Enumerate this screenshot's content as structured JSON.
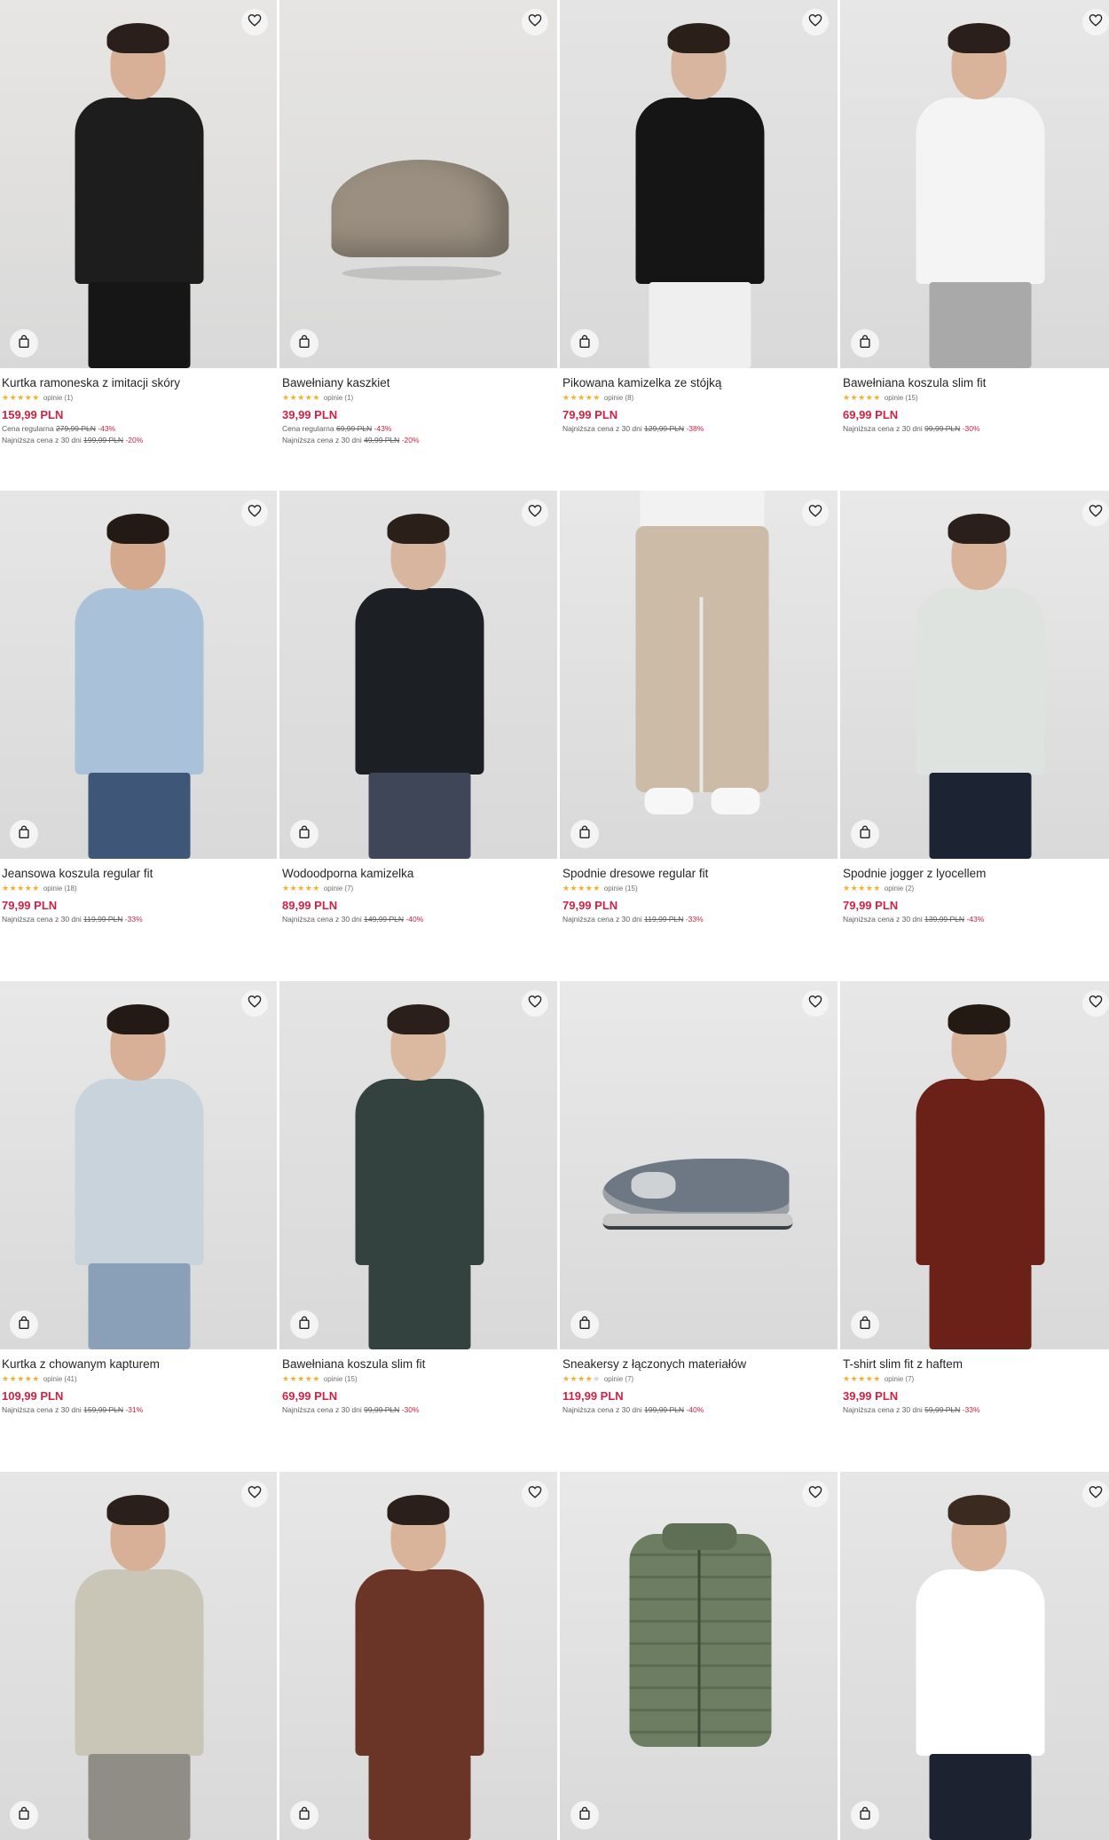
{
  "products": [
    {
      "name": "Kurtka ramoneska z imitacji skóry",
      "stars": 5,
      "reviews": "opinie (1)",
      "price": "159,99 PLN",
      "regular_label": "Cena regularna",
      "regular_old": "279,99 PLN",
      "regular_disc": "-43%",
      "lowest_label": "Najniższa cena z 30 dni",
      "lowest_old": "199,99 PLN",
      "lowest_disc": "-20%",
      "image": "model-black-leather-jacket",
      "bg": "#e8e6e4",
      "skin": "#d7b097",
      "top": "#1d1d1d",
      "bottom": "#161616",
      "hair": "#2a1f1a"
    },
    {
      "name": "Bawełniany kaszkiet",
      "stars": 5,
      "reviews": "opinie (1)",
      "price": "39,99 PLN",
      "regular_label": "Cena regularna",
      "regular_old": "69,99 PLN",
      "regular_disc": "-43%",
      "lowest_label": "Najniższa cena z 30 dni",
      "lowest_old": "49,99 PLN",
      "lowest_disc": "-20%",
      "image": "flat-cap",
      "bg": "#e6e5e3",
      "top": "#9a8f80"
    },
    {
      "name": "Pikowana kamizelka ze stójką",
      "stars": 5,
      "reviews": "opinie (8)",
      "price": "79,99 PLN",
      "lowest_label": "Najniższa cena z 30 dni",
      "lowest_old": "129,99 PLN",
      "lowest_disc": "-38%",
      "image": "model-black-puffer-vest",
      "bg": "#e4e4e4",
      "skin": "#d8b59f",
      "top": "#151515",
      "bottom": "#efefef",
      "hair": "#2b2019"
    },
    {
      "name": "Bawełniana koszula slim fit",
      "stars": 5,
      "reviews": "opinie (15)",
      "price": "69,99 PLN",
      "lowest_label": "Najniższa cena z 30 dni",
      "lowest_old": "99,99 PLN",
      "lowest_disc": "-30%",
      "image": "model-white-dotted-shirt",
      "bg": "#e7e7e7",
      "skin": "#d9b49a",
      "top": "#f4f4f4",
      "bottom": "#a9a9a9",
      "hair": "#2a1f1a"
    },
    {
      "name": "Jeansowa koszula regular fit",
      "stars": 5,
      "reviews": "opinie (18)",
      "price": "79,99 PLN",
      "lowest_label": "Najniższa cena z 30 dni",
      "lowest_old": "119,99 PLN",
      "lowest_disc": "-33%",
      "image": "model-denim-shirt",
      "bg": "#e6e6e6",
      "skin": "#d5a98d",
      "top": "#a9c2da",
      "bottom": "#3e5678",
      "hair": "#231a15"
    },
    {
      "name": "Wodoodporna kamizelka",
      "stars": 5,
      "reviews": "opinie (7)",
      "price": "89,99 PLN",
      "lowest_label": "Najniższa cena z 30 dni",
      "lowest_old": "149,99 PLN",
      "lowest_disc": "-40%",
      "image": "model-quilted-vest",
      "bg": "#e3e3e3",
      "skin": "#d8b59f",
      "top": "#1c1f24",
      "bottom": "#3e4657",
      "hair": "#2a2019"
    },
    {
      "name": "Spodnie dresowe regular fit",
      "stars": 5,
      "reviews": "opinie (15)",
      "price": "79,99 PLN",
      "lowest_label": "Najniższa cena z 30 dni",
      "lowest_old": "119,99 PLN",
      "lowest_disc": "-33%",
      "image": "beige-sweatpants",
      "bg": "#e8e8e8",
      "top": "#f2f2f2",
      "bottom": "#cbbba7"
    },
    {
      "name": "Spodnie jogger z lyocellem",
      "stars": 5,
      "reviews": "opinie (2)",
      "price": "79,99 PLN",
      "lowest_label": "Najniższa cena z 30 dni",
      "lowest_old": "139,99 PLN",
      "lowest_disc": "-43%",
      "image": "model-striped-overshirt",
      "bg": "#e9e9e9",
      "skin": "#d9b49a",
      "top": "#dfe3df",
      "bottom": "#1c2433",
      "hair": "#2a1f1a"
    },
    {
      "name": "Kurtka z chowanym kapturem",
      "stars": 5,
      "reviews": "opinie (41)",
      "price": "109,99 PLN",
      "lowest_label": "Najniższa cena z 30 dni",
      "lowest_old": "159,99 PLN",
      "lowest_disc": "-31%",
      "image": "model-light-blue-jacket",
      "bg": "#e8e8e8",
      "skin": "#d7b097",
      "top": "#c9d3dc",
      "bottom": "#8aa0b8",
      "hair": "#231a15"
    },
    {
      "name": "Bawełniana koszula slim fit",
      "stars": 5,
      "reviews": "opinie (15)",
      "price": "69,99 PLN",
      "lowest_label": "Najniższa cena z 30 dni",
      "lowest_old": "99,99 PLN",
      "lowest_disc": "-30%",
      "image": "model-dark-green-shirt",
      "bg": "#e4e4e4",
      "skin": "#dbb9a1",
      "top": "#34423f",
      "bottom": "#34423f",
      "hair": "#2a1f1a"
    },
    {
      "name": "Sneakersy z łączonych materiałów",
      "stars": 4,
      "reviews": "opinie (7)",
      "price": "119,99 PLN",
      "lowest_label": "Najniższa cena z 30 dni",
      "lowest_old": "199,99 PLN",
      "lowest_disc": "-40%",
      "image": "grey-sneaker",
      "bg": "#e9e9e9",
      "top": "#6d7884"
    },
    {
      "name": "T-shirt slim fit z haftem",
      "stars": 5,
      "reviews": "opinie (7)",
      "price": "39,99 PLN",
      "lowest_label": "Najniższa cena z 30 dni",
      "lowest_old": "59,99 PLN",
      "lowest_disc": "-33%",
      "image": "model-burgundy-tshirt",
      "bg": "#e7e7e7",
      "skin": "#d9b49a",
      "top": "#6b2118",
      "bottom": "#6b2118",
      "hair": "#241a14"
    },
    {
      "name": "",
      "image": "model-beige-shirt-cargo",
      "bg": "#e6e6e6",
      "skin": "#d7b097",
      "top": "#c9c6b8",
      "bottom": "#8f8d86",
      "hair": "#2a1f1a"
    },
    {
      "name": "",
      "image": "model-brown-henley",
      "bg": "#e7e7e7",
      "skin": "#d9b49a",
      "top": "#6a3427",
      "bottom": "#6a3427",
      "hair": "#2a1f1a"
    },
    {
      "name": "",
      "image": "green-puffer-vest",
      "bg": "#e9e9e9",
      "top": "#6c7d62"
    },
    {
      "name": "",
      "image": "model-white-graphic-tshirt",
      "bg": "#e6e6e6",
      "skin": "#d9b49a",
      "top": "#ffffff",
      "bottom": "#1d2230",
      "hair": "#3a2a20"
    }
  ],
  "icons": {
    "favorite": "heart-icon",
    "cart": "shopping-bag-icon"
  }
}
